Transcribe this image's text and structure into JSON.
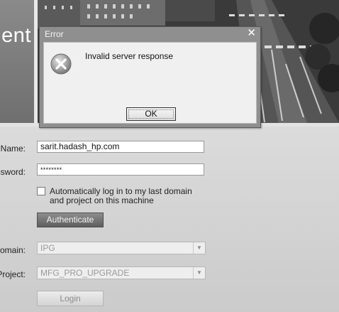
{
  "banner": {
    "title_fragment": "nent"
  },
  "form": {
    "username_label": "n Name:",
    "username_value": "sarit.hadash_hp.com",
    "password_label": "ssword:",
    "password_value": "********",
    "auto_login_label": "Automatically log in to my last domain and project on this machine",
    "auto_login_checked": false,
    "authenticate_label": "Authenticate",
    "domain_label": "Domain:",
    "domain_value": "IPG",
    "project_label": "Project:",
    "project_value": "MFG_PRO_UPGRADE",
    "login_label": "Login"
  },
  "dialog": {
    "title": "Error",
    "close_glyph": "✕",
    "message": "Invalid server response",
    "ok_label": "OK",
    "icon": "error-icon"
  },
  "colors": {
    "auth_button": "#6e6e6e",
    "dialog_frame": "#8f8f8f"
  }
}
